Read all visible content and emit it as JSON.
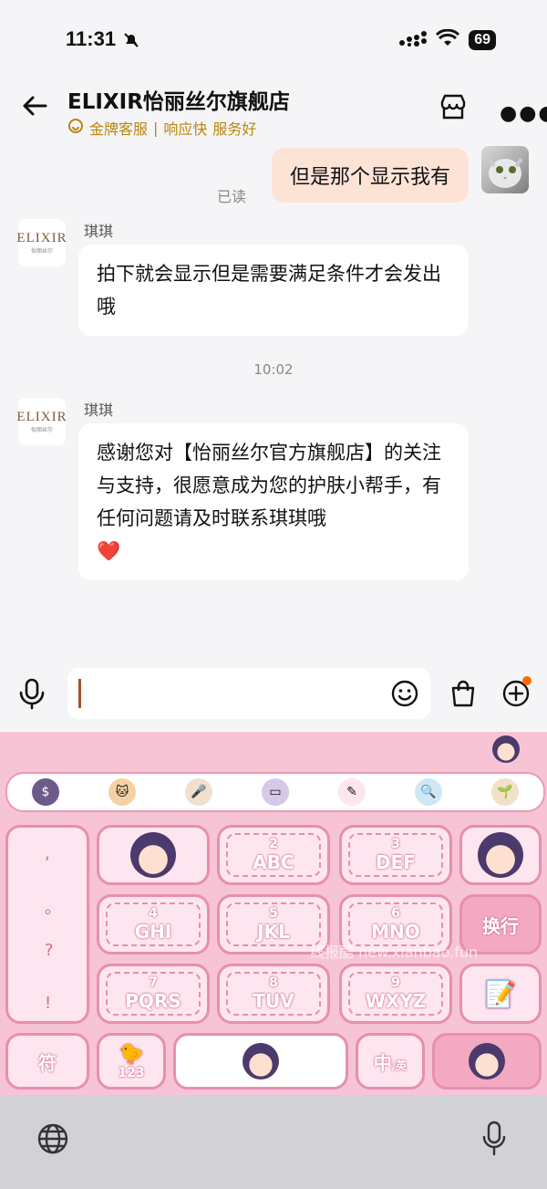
{
  "status_bar": {
    "time": "11:31",
    "battery": "69"
  },
  "header": {
    "title": "ELIXIR怡丽丝尔旗舰店",
    "subtitle_parts": [
      "金牌客服",
      "|",
      "响应快",
      "服务好"
    ]
  },
  "messages": [
    {
      "from": "me",
      "text": "但是那个显示我有",
      "status": "已读"
    },
    {
      "from": "agent",
      "sender": "琪琪",
      "avatar_text": "ELIXIR",
      "avatar_sub": "怡丽丝尔",
      "text": "拍下就会显示但是需要满足条件才会发出哦"
    },
    {
      "type": "timestamp",
      "text": "10:02"
    },
    {
      "from": "agent",
      "sender": "琪琪",
      "avatar_text": "ELIXIR",
      "avatar_sub": "怡丽丝尔",
      "text": "感谢您对【怡丽丝尔官方旗舰店】的关注与支持，很愿意成为您的护肤小帮手，有任何问题请及时联系琪琪哦",
      "emoji": "❤️"
    }
  ],
  "keyboard": {
    "punctuation": [
      ",",
      "。",
      "?",
      "!"
    ],
    "keys": [
      {
        "num": "2",
        "letters": "ABC"
      },
      {
        "num": "3",
        "letters": "DEF"
      },
      {
        "num": "4",
        "letters": "GHI"
      },
      {
        "num": "5",
        "letters": "JKL"
      },
      {
        "num": "6",
        "letters": "MNO"
      },
      {
        "num": "7",
        "letters": "PQRS"
      },
      {
        "num": "8",
        "letters": "TUV"
      },
      {
        "num": "9",
        "letters": "WXYZ"
      }
    ],
    "enter_label": "换行",
    "symbol_label": "符",
    "num_label": "123",
    "lang_label": "中",
    "lang_sub": "/英",
    "watermark": "线报酷 new.xianbao.fun"
  },
  "colors": {
    "accent": "#e78fae",
    "bubble_mine": "#fde3d6",
    "gold": "#b8860b"
  }
}
